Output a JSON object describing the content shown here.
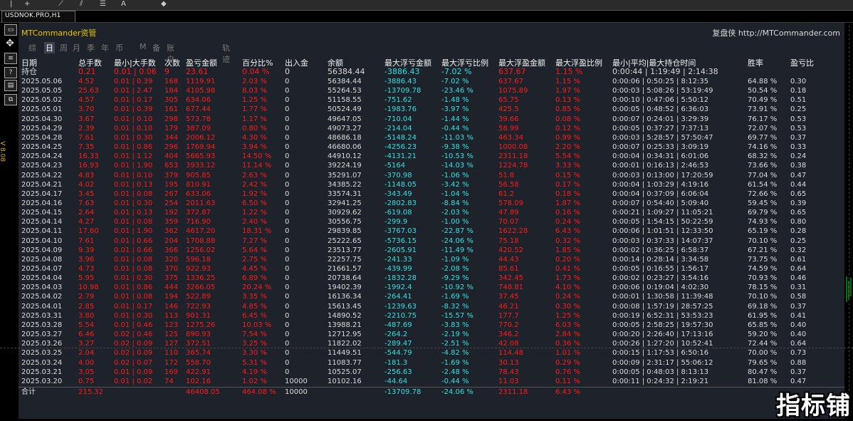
{
  "toolbar": {
    "icons": [
      "cursor-icon",
      "crosshair-icon",
      "trendline-icon",
      "channel-icon",
      "fibo-icon",
      "text-icon",
      "arrows-icon"
    ]
  },
  "symbol_tab": "USDNOK.PRO,H1",
  "left_toolbar": {
    "vertical_label": "V 8.08"
  },
  "panel": {
    "title": "MTCommander资管",
    "link": "复盘侠 http://MTCommander.com",
    "tabs": [
      "综",
      "日",
      "周",
      "月",
      "季",
      "年",
      "币",
      "M",
      "备",
      "账户",
      "轨迹"
    ],
    "active_tab": "日"
  },
  "columns": [
    "日期",
    "总手数",
    "最小|大手数",
    "次数",
    "盈亏金额",
    "百分比%",
    "出入金",
    "余额",
    "最大浮亏金额",
    "最大浮亏比例",
    "最大浮盈金额",
    "最大浮盈比例",
    "最小|平均|最大持仓时间",
    "胜率",
    "盈亏比"
  ],
  "hold_row": [
    "持仓",
    "0.21",
    "0.01 | 0.06",
    "9",
    "23.61",
    "0.04 %",
    "0",
    "56384.44",
    "-3886.43",
    "-7.02 %",
    "637.67",
    "1.15 %",
    "0:00:44 | 1:19:49 | 2:14:38",
    "",
    ""
  ],
  "rows": [
    [
      "2025.05.06",
      "4.52",
      "0.01 | 0.39",
      "168",
      "1119.91",
      "2.03 %",
      "0",
      "56384.44",
      "-3886.43",
      "-7.02 %",
      "637.67",
      "1.15 %",
      "0:00:06 | 0:50:25 | 8:12:35",
      "64.88 %",
      "0.30"
    ],
    [
      "2025.05.05",
      "25.63",
      "0.01 | 2.47",
      "184",
      "4105.98",
      "8.03 %",
      "0",
      "55264.53",
      "-13709.78",
      "-23.46 %",
      "1075.89",
      "1.97 %",
      "0:00:03 | 5:08:26 | 53:19:49",
      "50.54 %",
      "0.18"
    ],
    [
      "2025.05.02",
      "4.57",
      "0.01 | 0.17",
      "305",
      "634.06",
      "1.25 %",
      "0",
      "51158.55",
      "-751.62",
      "-1.48 %",
      "65.75",
      "0.13 %",
      "0:00:10 | 0:47:06 | 5:50:12",
      "70.49 %",
      "0.51"
    ],
    [
      "2025.05.01",
      "3.70",
      "0.01 | 0.39",
      "161",
      "677.44",
      "1.77 %",
      "0",
      "50524.49",
      "-1983.76",
      "-3.97 %",
      "425.5",
      "0.85 %",
      "0:00:05 | 0:48:52 | 6:36:03",
      "73.91 %",
      "0.25"
    ],
    [
      "2025.04.30",
      "3.67",
      "0.01 | 0.10",
      "298",
      "573.78",
      "1.17 %",
      "0",
      "49647.05",
      "-710.04",
      "-1.44 %",
      "39.66",
      "0.08 %",
      "0:00:07 | 0:24:01 | 3:29:39",
      "76.17 %",
      "0.53"
    ],
    [
      "2025.04.29",
      "2.39",
      "0.01 | 0.10",
      "179",
      "387.09",
      "0.80 %",
      "0",
      "49073.27",
      "-214.04",
      "-0.44 %",
      "58.99",
      "0.12 %",
      "0:00:05 | 0:37:27 | 7:37:13",
      "72.07 %",
      "0.53"
    ],
    [
      "2025.04.28",
      "7.61",
      "0.01 | 0.30",
      "344",
      "2006.12",
      "4.30 %",
      "0",
      "48686.18",
      "-5148.24",
      "-11.03 %",
      "463.34",
      "0.99 %",
      "0:00:03 | 5:28:57 | 57:50:47",
      "69.77 %",
      "0.37"
    ],
    [
      "2025.04.25",
      "7.35",
      "0.01 | 0.86",
      "296",
      "1769.94",
      "3.94 %",
      "0",
      "46680.06",
      "-4256.23",
      "-9.38 %",
      "1000.08",
      "2.20 %",
      "0:00:07 | 0:25:33 | 3:09:19",
      "74.16 %",
      "0.33"
    ],
    [
      "2025.04.24",
      "16.33",
      "0.01 | 1.12",
      "404",
      "5665.93",
      "14.50 %",
      "0",
      "44910.12",
      "-4131.21",
      "-10.53 %",
      "2311.18",
      "5.54 %",
      "0:00:04 | 0:34:31 | 6:01:06",
      "68.32 %",
      "0.24"
    ],
    [
      "2025.04.23",
      "16.93",
      "0.01 | 1.90",
      "653",
      "3933.12",
      "11.14 %",
      "0",
      "39224.19",
      "-5164",
      "-14.03 %",
      "1224.78",
      "3.33 %",
      "0:00:01 | 0:16:13 | 2:46:53",
      "73.66 %",
      "0.38"
    ],
    [
      "2025.04.22",
      "4.83",
      "0.01 | 0.10",
      "379",
      "905.85",
      "2.63 %",
      "0",
      "35291.07",
      "-370.98",
      "-1.06 %",
      "51.8",
      "0.15 %",
      "0:00:03 | 0:13:00 | 17:20:59",
      "77.04 %",
      "0.47"
    ],
    [
      "2025.04.21",
      "4.02",
      "0.01 | 0.13",
      "195",
      "810.91",
      "2.42 %",
      "0",
      "34385.22",
      "-1148.05",
      "-3.42 %",
      "56.58",
      "0.17 %",
      "0:00:04 | 1:03:29 | 4:19:16",
      "61.54 %",
      "0.44"
    ],
    [
      "2025.04.17",
      "3.45",
      "0.01 | 0.08",
      "267",
      "633.06",
      "1.92 %",
      "0",
      "33574.31",
      "-343.49",
      "-1.04 %",
      "61.2",
      "0.18 %",
      "0:00:04 | 0:37:09 | 6:06:04",
      "72.66 %",
      "0.65"
    ],
    [
      "2025.04.16",
      "7.63",
      "0.01 | 0.30",
      "254",
      "2011.63",
      "6.50 %",
      "0",
      "32941.25",
      "-2802.83",
      "-8.84 %",
      "578.09",
      "1.87 %",
      "0:00:07 | 0:54:40 | 5:09:40",
      "59.45 %",
      "0.39"
    ],
    [
      "2025.04.15",
      "2.64",
      "0.01 | 0.13",
      "192",
      "372.87",
      "1.22 %",
      "0",
      "30929.62",
      "-619.08",
      "-2.03 %",
      "47.89",
      "0.16 %",
      "0:00:21 | 1:09:27 | 11:05:21",
      "69.79 %",
      "0.65"
    ],
    [
      "2025.04.14",
      "4.27",
      "0.01 | 0.08",
      "359",
      "716.90",
      "2.40 %",
      "0",
      "30556.75",
      "-299.9",
      "-1.00 %",
      "70.07",
      "0.24 %",
      "0:00:05 | 1:54:15 | 50:22:59",
      "74.93 %",
      "0.80"
    ],
    [
      "2025.04.11",
      "17.60",
      "0.01 | 1.90",
      "362",
      "4617.20",
      "18.31 %",
      "0",
      "29839.85",
      "-3767.03",
      "-22.87 %",
      "1622.28",
      "6.43 %",
      "0:00:06 | 1:01:51 | 12:33:50",
      "65.19 %",
      "0.28"
    ],
    [
      "2025.04.10",
      "7.61",
      "0.01 | 0.66",
      "204",
      "1708.88",
      "7.27 %",
      "0",
      "25222.65",
      "-5736.15",
      "-24.06 %",
      "75.18",
      "0.32 %",
      "0:00:03 | 0:37:33 | 14:07:37",
      "70.10 %",
      "0.25"
    ],
    [
      "2025.04.09",
      "9.39",
      "0.01 | 0.66",
      "366",
      "1256.02",
      "5.64 %",
      "0",
      "23513.77",
      "-2605.91",
      "-11.49 %",
      "420.52",
      "1.85 %",
      "0:00:02 | 0:36:25 | 6:58:37",
      "67.21 %",
      "0.32"
    ],
    [
      "2025.04.08",
      "3.96",
      "0.01 | 0.08",
      "320",
      "596.18",
      "2.75 %",
      "0",
      "22257.75",
      "-241.33",
      "-1.09 %",
      "44.43",
      "0.20 %",
      "0:00:14 | 0:28:14 | 3:34:58",
      "73.75 %",
      "0.61"
    ],
    [
      "2025.04.07",
      "4.73",
      "0.01 | 0.08",
      "370",
      "922.93",
      "4.45 %",
      "0",
      "21661.57",
      "-439.99",
      "-2.08 %",
      "85.61",
      "0.41 %",
      "0:00:05 | 0:16:55 | 1:56:17",
      "74.59 %",
      "0.64"
    ],
    [
      "2025.04.04",
      "5.95",
      "0.01 | 0.30",
      "375",
      "1336.25",
      "6.89 %",
      "0",
      "20738.64",
      "-1832.28",
      "-9.29 %",
      "342.45",
      "1.73 %",
      "0:00:02 | 0:23:27 | 3:54:16",
      "70.93 %",
      "0.46"
    ],
    [
      "2025.04.03",
      "10.98",
      "0.01 | 0.86",
      "444",
      "3266.05",
      "20.24 %",
      "0",
      "19402.39",
      "-1992.4",
      "-10.92 %",
      "748.81",
      "4.10 %",
      "0:00:06 | 0:19:04 | 4:02:30",
      "78.15 %",
      "0.31"
    ],
    [
      "2025.04.02",
      "2.79",
      "0.01 | 0.08",
      "194",
      "522.89",
      "3.35 %",
      "0",
      "16136.34",
      "-264.41",
      "-1.69 %",
      "37.45",
      "0.24 %",
      "0:00:01 | 1:30:58 | 11:39:48",
      "70.10 %",
      "0.58"
    ],
    [
      "2025.04.01",
      "2.85",
      "0.01 | 0.17",
      "146",
      "722.93",
      "4.85 %",
      "0",
      "15613.45",
      "-1239.63",
      "-8.32 %",
      "46.21",
      "0.30 %",
      "0:00:08 | 1:57:19 | 28:57:25",
      "69.18 %",
      "0.37"
    ],
    [
      "2025.03.31",
      "3.80",
      "0.01 | 0.30",
      "113",
      "901.31",
      "6.45 %",
      "0",
      "14890.52",
      "-2210.75",
      "-15.57 %",
      "177.7",
      "1.25 %",
      "0:00:19 | 6:52:31 | 53:53:23",
      "61.95 %",
      "0.41"
    ],
    [
      "2025.03.28",
      "5.54",
      "0.01 | 0.46",
      "123",
      "1275.26",
      "10.03 %",
      "0",
      "13988.21",
      "-487.69",
      "-3.83 %",
      "770.2",
      "6.03 %",
      "0:00:05 | 2:58:25 | 19:57:30",
      "65.85 %",
      "0.40"
    ],
    [
      "2025.03.27",
      "6.46",
      "0.02 | 0.46",
      "125",
      "890.93",
      "7.54 %",
      "0",
      "12712.95",
      "-264.2",
      "-2.19 %",
      "346.2",
      "2.84 %",
      "0:00:20 | 2:26:40 | 17:13:16",
      "59.20 %",
      "0.40"
    ],
    [
      "2025.03.26",
      "3.27",
      "0.02 | 0.09",
      "127",
      "372.51",
      "3.25 %",
      "0",
      "11822.02",
      "-289.47",
      "-2.51 %",
      "42.08",
      "0.36 %",
      "0:00:26 | 1:27:20 | 10:52:41",
      "72.44 %",
      "0.64"
    ],
    [
      "2025.03.25",
      "2.04",
      "0.02 | 0.09",
      "110",
      "365.74",
      "3.30 %",
      "0",
      "11449.51",
      "-544.79",
      "-4.82 %",
      "114.48",
      "1.01 %",
      "0:00:15 | 1:17:53 | 6:50:16",
      "70.00 %",
      "0.73"
    ],
    [
      "2025.03.24",
      "4.00",
      "0.02 | 0.07",
      "172",
      "558.70",
      "5.31 %",
      "0",
      "11083.77",
      "-181.3",
      "-1.69 %",
      "30.13",
      "0.29 %",
      "0:00:09 | 2:31:17 | 55:06:12",
      "79.65 %",
      "0.88"
    ],
    [
      "2025.03.21",
      "3.05",
      "0.01 | 0.09",
      "169",
      "422.91",
      "4.19 %",
      "0",
      "10525.07",
      "-256.63",
      "-2.48 %",
      "78.43",
      "0.76 %",
      "0:00:05 | 0:48:03 | 8:13:13",
      "80.47 %",
      "0.37"
    ],
    [
      "2025.03.20",
      "0.75",
      "0.01 | 0.02",
      "74",
      "102.16",
      "1.02 %",
      "10000",
      "10102.16",
      "-44.64",
      "-0.44 %",
      "11.03",
      "0.11 %",
      "0:00:11 | 0:24:32 | 2:19:21",
      "81.08 %",
      "0.47"
    ]
  ],
  "total_row": [
    "合计",
    "215.32",
    "",
    "",
    "46408.05",
    "464.08 %",
    "10000",
    "",
    "-13709.78",
    "-24.06 %",
    "2311.18",
    "6.43 %",
    "",
    "",
    ""
  ],
  "watermark": "指标铺"
}
